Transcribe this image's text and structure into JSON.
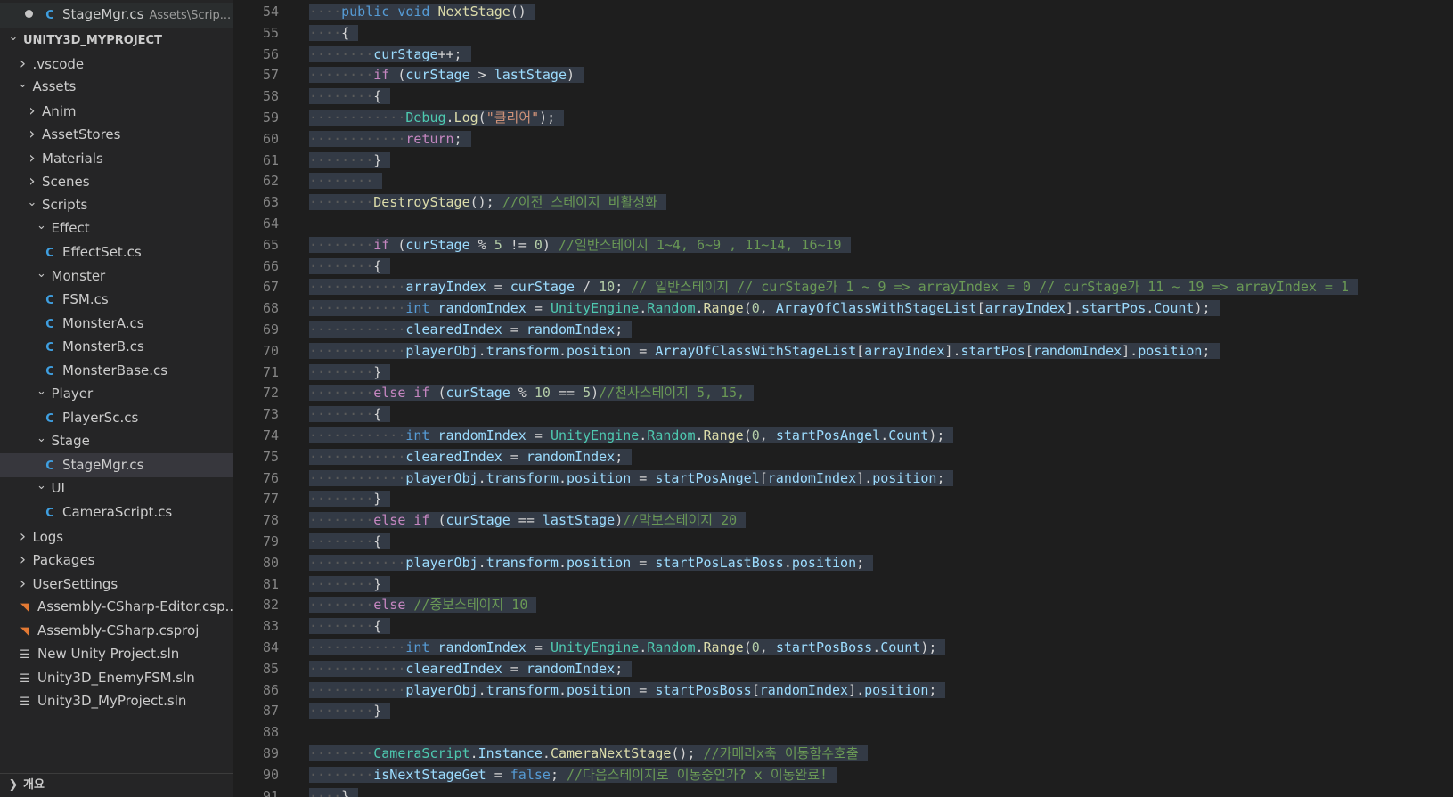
{
  "sidebar": {
    "open_editor": {
      "name": "StageMgr.cs",
      "path": "Assets\\Scrip..."
    },
    "items": [
      {
        "label": "UNITY3D_MYPROJECT",
        "kind": "root",
        "depth": 0
      },
      {
        "label": ".vscode",
        "kind": "folder-closed",
        "depth": 1
      },
      {
        "label": "Assets",
        "kind": "folder-open",
        "depth": 1
      },
      {
        "label": "Anim",
        "kind": "folder-closed",
        "depth": 2
      },
      {
        "label": "AssetStores",
        "kind": "folder-closed",
        "depth": 2
      },
      {
        "label": "Materials",
        "kind": "folder-closed",
        "depth": 2
      },
      {
        "label": "Scenes",
        "kind": "folder-closed",
        "depth": 2
      },
      {
        "label": "Scripts",
        "kind": "folder-open",
        "depth": 2
      },
      {
        "label": "Effect",
        "kind": "folder-open",
        "depth": 3
      },
      {
        "label": "EffectSet.cs",
        "kind": "cs",
        "depth": 4
      },
      {
        "label": "Monster",
        "kind": "folder-open",
        "depth": 3
      },
      {
        "label": "FSM.cs",
        "kind": "cs",
        "depth": 4
      },
      {
        "label": "MonsterA.cs",
        "kind": "cs",
        "depth": 4
      },
      {
        "label": "MonsterB.cs",
        "kind": "cs",
        "depth": 4
      },
      {
        "label": "MonsterBase.cs",
        "kind": "cs",
        "depth": 4
      },
      {
        "label": "Player",
        "kind": "folder-open",
        "depth": 3
      },
      {
        "label": "PlayerSc.cs",
        "kind": "cs",
        "depth": 4
      },
      {
        "label": "Stage",
        "kind": "folder-open",
        "depth": 3
      },
      {
        "label": "StageMgr.cs",
        "kind": "cs",
        "depth": 4,
        "selected": true
      },
      {
        "label": "UI",
        "kind": "folder-open",
        "depth": 3
      },
      {
        "label": "CameraScript.cs",
        "kind": "cs",
        "depth": 4
      },
      {
        "label": "Logs",
        "kind": "folder-closed",
        "depth": 1
      },
      {
        "label": "Packages",
        "kind": "folder-closed",
        "depth": 1
      },
      {
        "label": "UserSettings",
        "kind": "folder-closed",
        "depth": 1
      },
      {
        "label": "Assembly-CSharp-Editor.csp...",
        "kind": "rss",
        "depth": 1
      },
      {
        "label": "Assembly-CSharp.csproj",
        "kind": "rss",
        "depth": 1
      },
      {
        "label": "New Unity Project.sln",
        "kind": "sln",
        "depth": 1
      },
      {
        "label": "Unity3D_EnemyFSM.sln",
        "kind": "sln",
        "depth": 1
      },
      {
        "label": "Unity3D_MyProject.sln",
        "kind": "sln",
        "depth": 1
      }
    ],
    "outline_label": "개요"
  },
  "icons": {
    "modified": "modified-dot-icon",
    "chevron_down": "chevron-down-icon",
    "chevron_right": "chevron-right-icon",
    "csharp": "csharp-file-icon",
    "rss": "rss-file-icon",
    "sln": "solution-file-icon"
  },
  "editor": {
    "lines": [
      {
        "n": "54",
        "indent": 1,
        "tokens": [
          [
            "kb",
            "public"
          ],
          [
            "pn",
            " "
          ],
          [
            "kb",
            "void"
          ],
          [
            "pn",
            " "
          ],
          [
            "fn",
            "NextStage"
          ],
          [
            "pn",
            "()"
          ]
        ]
      },
      {
        "n": "55",
        "indent": 1,
        "tokens": [
          [
            "pn",
            "{"
          ]
        ]
      },
      {
        "n": "56",
        "indent": 2,
        "tokens": [
          [
            "vr",
            "curStage"
          ],
          [
            "pn",
            "++;"
          ]
        ]
      },
      {
        "n": "57",
        "indent": 2,
        "tokens": [
          [
            "kw",
            "if"
          ],
          [
            "pn",
            " ("
          ],
          [
            "vr",
            "curStage"
          ],
          [
            "pn",
            " > "
          ],
          [
            "vr",
            "lastStage"
          ],
          [
            "pn",
            ")"
          ]
        ]
      },
      {
        "n": "58",
        "indent": 2,
        "tokens": [
          [
            "pn",
            "{"
          ]
        ]
      },
      {
        "n": "59",
        "indent": 3,
        "tokens": [
          [
            "ty",
            "Debug"
          ],
          [
            "pn",
            "."
          ],
          [
            "fn",
            "Log"
          ],
          [
            "pn",
            "("
          ],
          [
            "st",
            "\"클리어\""
          ],
          [
            "pn",
            ");"
          ]
        ]
      },
      {
        "n": "60",
        "indent": 3,
        "tokens": [
          [
            "kw",
            "return"
          ],
          [
            "pn",
            ";"
          ]
        ]
      },
      {
        "n": "61",
        "indent": 2,
        "tokens": [
          [
            "pn",
            "}"
          ]
        ]
      },
      {
        "n": "62",
        "indent": 2,
        "tokens": []
      },
      {
        "n": "63",
        "indent": 2,
        "tokens": [
          [
            "fn",
            "DestroyStage"
          ],
          [
            "pn",
            "(); "
          ],
          [
            "cm",
            "//이전 스테이지 비활성화"
          ]
        ]
      },
      {
        "n": "64",
        "indent": 0,
        "tokens": []
      },
      {
        "n": "65",
        "indent": 2,
        "tokens": [
          [
            "kw",
            "if"
          ],
          [
            "pn",
            " ("
          ],
          [
            "vr",
            "curStage"
          ],
          [
            "pn",
            " % "
          ],
          [
            "nm",
            "5"
          ],
          [
            "pn",
            " != "
          ],
          [
            "nm",
            "0"
          ],
          [
            "pn",
            ") "
          ],
          [
            "cm",
            "//일반스테이지 1~4, 6~9 , 11~14, 16~19"
          ]
        ]
      },
      {
        "n": "66",
        "indent": 2,
        "tokens": [
          [
            "pn",
            "{"
          ]
        ]
      },
      {
        "n": "67",
        "indent": 3,
        "tokens": [
          [
            "vr",
            "arrayIndex"
          ],
          [
            "pn",
            " = "
          ],
          [
            "vr",
            "curStage"
          ],
          [
            "pn",
            " / "
          ],
          [
            "nm",
            "10"
          ],
          [
            "pn",
            "; "
          ],
          [
            "cm",
            "// 일반스테이지 // curStage가 1 ~ 9 => arrayIndex = 0 // curStage가 11 ~ 19 => arrayIndex = 1"
          ]
        ]
      },
      {
        "n": "68",
        "indent": 3,
        "tokens": [
          [
            "kb",
            "int"
          ],
          [
            "pn",
            " "
          ],
          [
            "vr",
            "randomIndex"
          ],
          [
            "pn",
            " = "
          ],
          [
            "ty",
            "UnityEngine"
          ],
          [
            "pn",
            "."
          ],
          [
            "ty",
            "Random"
          ],
          [
            "pn",
            "."
          ],
          [
            "fn",
            "Range"
          ],
          [
            "pn",
            "("
          ],
          [
            "nm",
            "0"
          ],
          [
            "pn",
            ", "
          ],
          [
            "vr",
            "ArrayOfClassWithStageList"
          ],
          [
            "pn",
            "["
          ],
          [
            "vr",
            "arrayIndex"
          ],
          [
            "pn",
            "]."
          ],
          [
            "vr",
            "startPos"
          ],
          [
            "pn",
            "."
          ],
          [
            "vr",
            "Count"
          ],
          [
            "pn",
            ");"
          ]
        ]
      },
      {
        "n": "69",
        "indent": 3,
        "tokens": [
          [
            "vr",
            "clearedIndex"
          ],
          [
            "pn",
            " = "
          ],
          [
            "vr",
            "randomIndex"
          ],
          [
            "pn",
            ";"
          ]
        ]
      },
      {
        "n": "70",
        "indent": 3,
        "tokens": [
          [
            "vr",
            "playerObj"
          ],
          [
            "pn",
            "."
          ],
          [
            "vr",
            "transform"
          ],
          [
            "pn",
            "."
          ],
          [
            "vr",
            "position"
          ],
          [
            "pn",
            " = "
          ],
          [
            "vr",
            "ArrayOfClassWithStageList"
          ],
          [
            "pn",
            "["
          ],
          [
            "vr",
            "arrayIndex"
          ],
          [
            "pn",
            "]."
          ],
          [
            "vr",
            "startPos"
          ],
          [
            "pn",
            "["
          ],
          [
            "vr",
            "randomIndex"
          ],
          [
            "pn",
            "]."
          ],
          [
            "vr",
            "position"
          ],
          [
            "pn",
            ";"
          ]
        ]
      },
      {
        "n": "71",
        "indent": 2,
        "tokens": [
          [
            "pn",
            "}"
          ]
        ]
      },
      {
        "n": "72",
        "indent": 2,
        "tokens": [
          [
            "kw",
            "else"
          ],
          [
            "pn",
            " "
          ],
          [
            "kw",
            "if"
          ],
          [
            "pn",
            " ("
          ],
          [
            "vr",
            "curStage"
          ],
          [
            "pn",
            " % "
          ],
          [
            "nm",
            "10"
          ],
          [
            "pn",
            " == "
          ],
          [
            "nm",
            "5"
          ],
          [
            "pn",
            ")"
          ],
          [
            "cm",
            "//천사스테이지 5, 15,"
          ]
        ]
      },
      {
        "n": "73",
        "indent": 2,
        "tokens": [
          [
            "pn",
            "{"
          ]
        ]
      },
      {
        "n": "74",
        "indent": 3,
        "tokens": [
          [
            "kb",
            "int"
          ],
          [
            "pn",
            " "
          ],
          [
            "vr",
            "randomIndex"
          ],
          [
            "pn",
            " = "
          ],
          [
            "ty",
            "UnityEngine"
          ],
          [
            "pn",
            "."
          ],
          [
            "ty",
            "Random"
          ],
          [
            "pn",
            "."
          ],
          [
            "fn",
            "Range"
          ],
          [
            "pn",
            "("
          ],
          [
            "nm",
            "0"
          ],
          [
            "pn",
            ", "
          ],
          [
            "vr",
            "startPosAngel"
          ],
          [
            "pn",
            "."
          ],
          [
            "vr",
            "Count"
          ],
          [
            "pn",
            ");"
          ]
        ]
      },
      {
        "n": "75",
        "indent": 3,
        "tokens": [
          [
            "vr",
            "clearedIndex"
          ],
          [
            "pn",
            " = "
          ],
          [
            "vr",
            "randomIndex"
          ],
          [
            "pn",
            ";"
          ]
        ]
      },
      {
        "n": "76",
        "indent": 3,
        "tokens": [
          [
            "vr",
            "playerObj"
          ],
          [
            "pn",
            "."
          ],
          [
            "vr",
            "transform"
          ],
          [
            "pn",
            "."
          ],
          [
            "vr",
            "position"
          ],
          [
            "pn",
            " = "
          ],
          [
            "vr",
            "startPosAngel"
          ],
          [
            "pn",
            "["
          ],
          [
            "vr",
            "randomIndex"
          ],
          [
            "pn",
            "]."
          ],
          [
            "vr",
            "position"
          ],
          [
            "pn",
            ";"
          ]
        ]
      },
      {
        "n": "77",
        "indent": 2,
        "tokens": [
          [
            "pn",
            "}"
          ]
        ]
      },
      {
        "n": "78",
        "indent": 2,
        "tokens": [
          [
            "kw",
            "else"
          ],
          [
            "pn",
            " "
          ],
          [
            "kw",
            "if"
          ],
          [
            "pn",
            " ("
          ],
          [
            "vr",
            "curStage"
          ],
          [
            "pn",
            " == "
          ],
          [
            "vr",
            "lastStage"
          ],
          [
            "pn",
            ")"
          ],
          [
            "cm",
            "//막보스테이지 20"
          ]
        ]
      },
      {
        "n": "79",
        "indent": 2,
        "tokens": [
          [
            "pn",
            "{"
          ]
        ]
      },
      {
        "n": "80",
        "indent": 3,
        "tokens": [
          [
            "vr",
            "playerObj"
          ],
          [
            "pn",
            "."
          ],
          [
            "vr",
            "transform"
          ],
          [
            "pn",
            "."
          ],
          [
            "vr",
            "position"
          ],
          [
            "pn",
            " = "
          ],
          [
            "vr",
            "startPosLastBoss"
          ],
          [
            "pn",
            "."
          ],
          [
            "vr",
            "position"
          ],
          [
            "pn",
            ";"
          ]
        ]
      },
      {
        "n": "81",
        "indent": 2,
        "tokens": [
          [
            "pn",
            "}"
          ]
        ]
      },
      {
        "n": "82",
        "indent": 2,
        "tokens": [
          [
            "kw",
            "else"
          ],
          [
            "pn",
            " "
          ],
          [
            "cm",
            "//중보스테이지 10"
          ]
        ]
      },
      {
        "n": "83",
        "indent": 2,
        "tokens": [
          [
            "pn",
            "{"
          ]
        ]
      },
      {
        "n": "84",
        "indent": 3,
        "tokens": [
          [
            "kb",
            "int"
          ],
          [
            "pn",
            " "
          ],
          [
            "vr",
            "randomIndex"
          ],
          [
            "pn",
            " = "
          ],
          [
            "ty",
            "UnityEngine"
          ],
          [
            "pn",
            "."
          ],
          [
            "ty",
            "Random"
          ],
          [
            "pn",
            "."
          ],
          [
            "fn",
            "Range"
          ],
          [
            "pn",
            "("
          ],
          [
            "nm",
            "0"
          ],
          [
            "pn",
            ", "
          ],
          [
            "vr",
            "startPosBoss"
          ],
          [
            "pn",
            "."
          ],
          [
            "vr",
            "Count"
          ],
          [
            "pn",
            ");"
          ]
        ]
      },
      {
        "n": "85",
        "indent": 3,
        "tokens": [
          [
            "vr",
            "clearedIndex"
          ],
          [
            "pn",
            " = "
          ],
          [
            "vr",
            "randomIndex"
          ],
          [
            "pn",
            ";"
          ]
        ]
      },
      {
        "n": "86",
        "indent": 3,
        "tokens": [
          [
            "vr",
            "playerObj"
          ],
          [
            "pn",
            "."
          ],
          [
            "vr",
            "transform"
          ],
          [
            "pn",
            "."
          ],
          [
            "vr",
            "position"
          ],
          [
            "pn",
            " = "
          ],
          [
            "vr",
            "startPosBoss"
          ],
          [
            "pn",
            "["
          ],
          [
            "vr",
            "randomIndex"
          ],
          [
            "pn",
            "]."
          ],
          [
            "vr",
            "position"
          ],
          [
            "pn",
            ";"
          ]
        ]
      },
      {
        "n": "87",
        "indent": 2,
        "tokens": [
          [
            "pn",
            "}"
          ]
        ]
      },
      {
        "n": "88",
        "indent": 0,
        "tokens": []
      },
      {
        "n": "89",
        "indent": 2,
        "tokens": [
          [
            "ty",
            "CameraScript"
          ],
          [
            "pn",
            "."
          ],
          [
            "vr",
            "Instance"
          ],
          [
            "pn",
            "."
          ],
          [
            "fn",
            "CameraNextStage"
          ],
          [
            "pn",
            "(); "
          ],
          [
            "cm",
            "//카메라x축 이동함수호출"
          ]
        ]
      },
      {
        "n": "90",
        "indent": 2,
        "tokens": [
          [
            "vr",
            "isNextStageGet"
          ],
          [
            "pn",
            " = "
          ],
          [
            "kb",
            "false"
          ],
          [
            "pn",
            "; "
          ],
          [
            "cm",
            "//다음스테이지로 이동중인가? x 이동완료!"
          ]
        ]
      },
      {
        "n": "91",
        "indent": 1,
        "tokens": [
          [
            "pn",
            "}"
          ]
        ]
      }
    ]
  }
}
